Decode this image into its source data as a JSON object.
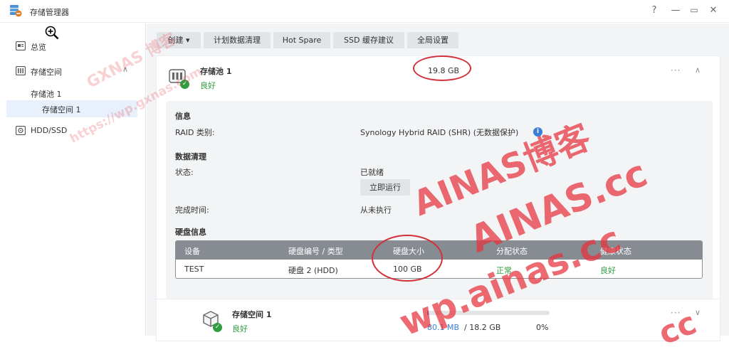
{
  "window": {
    "title": "存储管理器",
    "help": "?",
    "minimize": "—",
    "maximize": "▭",
    "close": "✕"
  },
  "sidebar": {
    "items": [
      {
        "label": "总览",
        "icon": "overview-icon"
      },
      {
        "label": "存储空间",
        "icon": "storage-icon",
        "expanded": true
      },
      {
        "label": "存储池 1"
      },
      {
        "label": "存储空间 1",
        "selected": true
      },
      {
        "label": "HDD/SSD",
        "icon": "disk-icon"
      }
    ],
    "chevron": "∧"
  },
  "toolbar": {
    "create": "创建 ▾",
    "scrub": "计划数据清理",
    "hotspare": "Hot Spare",
    "ssd": "SSD 缓存建议",
    "global": "全局设置"
  },
  "pool": {
    "name": "存储池 1",
    "status": "良好",
    "size": "19.8 GB",
    "more": "···",
    "collapse": "∧"
  },
  "info": {
    "title": "信息",
    "raid_label": "RAID 类别:",
    "raid_value": "Synology Hybrid RAID (SHR) (无数据保护)",
    "info_icon": "i"
  },
  "scrubbing": {
    "title": "数据清理",
    "status_label": "状态:",
    "status_value": "已就绪",
    "run_button": "立即运行",
    "done_label": "完成时间:",
    "done_value": "从未执行"
  },
  "disks": {
    "title": "硬盘信息",
    "headers": [
      "设备",
      "硬盘编号 / 类型",
      "硬盘大小",
      "分配状态",
      "健康状态"
    ],
    "rows": [
      {
        "device": "TEST",
        "disk": "硬盘 2 (HDD)",
        "size": "100 GB",
        "alloc": "正常",
        "health": "良好"
      }
    ]
  },
  "volume": {
    "name": "存储空间 1",
    "status": "良好",
    "usage": "80.1 MB",
    "total": "/ 18.2 GB",
    "percent": "0%",
    "fill_fraction": 0.01,
    "more": "···",
    "expand": "∨"
  },
  "watermarks": {
    "blog_cn": "GXNAS 博客",
    "blog_url": "https://wp.gxnas.com",
    "ainas_blog": "AINAS博客",
    "ainas_cc": "AINAS.cc",
    "ainas_url": "wp.ainas.cc",
    "ainas_partial": "cc"
  },
  "colors": {
    "accent": "#3a7fd5",
    "ok": "#2e9e3e",
    "watermark": "#e8323c",
    "header": "#878c92"
  }
}
